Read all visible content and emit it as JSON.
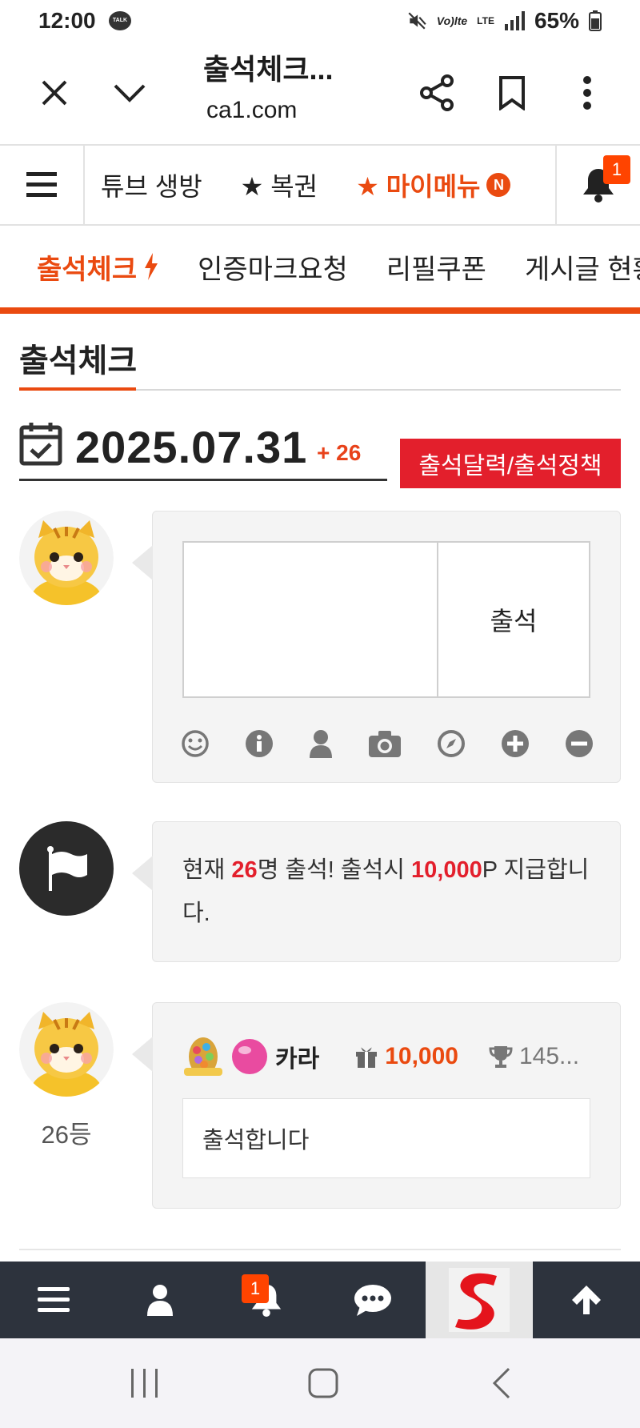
{
  "status_bar": {
    "time": "12:00",
    "talk_label": "TALK",
    "volte": "Vo)lte",
    "lte": "LTE",
    "battery": "65%"
  },
  "browser": {
    "title": "출석체크...",
    "url": "ca1.com",
    "icons": [
      "close-icon",
      "chevron-down-icon",
      "share-icon",
      "bookmark-icon",
      "more-vertical-icon"
    ]
  },
  "site_nav": {
    "items": [
      "튜브 생방",
      "★ 복권"
    ],
    "my_menu": "★ 마이메뉴",
    "new_badge": "N",
    "notif_count": "1"
  },
  "sub_tabs": {
    "active": "출석체크",
    "items": [
      "인증마크요청",
      "리필쿠폰",
      "게시글 현황"
    ]
  },
  "section": {
    "title": "출석체크"
  },
  "date_row": {
    "date": "2025.07.31",
    "plus": "+ 26",
    "policy_button": "출석달력/출석정책"
  },
  "form": {
    "textarea_value": "",
    "submit_label": "출석",
    "tool_icons": [
      "smile-icon",
      "info-icon",
      "user-icon",
      "camera-icon",
      "compass-icon",
      "plus-circle-icon",
      "minus-circle-icon"
    ]
  },
  "notice": {
    "prefix": "현재 ",
    "count": "26",
    "middle": "명 출석! 출석시 ",
    "points": "10,000",
    "suffix": "P 지급합니다."
  },
  "comment": {
    "nickname": "카라",
    "reward": "10,000",
    "trophy": "145...",
    "body": "출석합니다",
    "rank": "26등"
  },
  "bottom_bar": {
    "notif_count": "1",
    "icons": [
      "menu-icon",
      "user-icon",
      "bell-icon",
      "chat-icon",
      "site-logo",
      "arrow-up-icon"
    ]
  },
  "colors": {
    "accent": "#ea4a10",
    "red": "#e31f2c",
    "bottom_bar": "#2d333d"
  }
}
